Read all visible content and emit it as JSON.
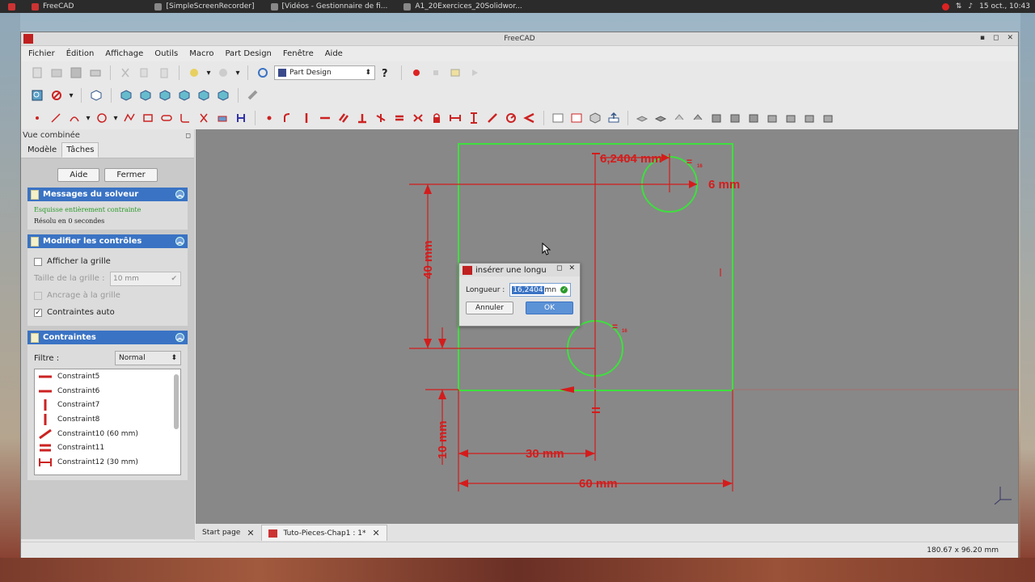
{
  "taskbar": {
    "tasks": [
      "FreeCAD",
      "[SimpleScreenRecorder]",
      "[Vidéos - Gestionnaire de fi...",
      "A1_20Exercices_20Solidwor..."
    ],
    "clock": "15 oct., 10:43"
  },
  "window": {
    "title": "FreeCAD",
    "menu": [
      "Fichier",
      "Édition",
      "Affichage",
      "Outils",
      "Macro",
      "Part Design",
      "Fenêtre",
      "Aide"
    ],
    "workbench": "Part Design"
  },
  "panel": {
    "title": "Vue combinée",
    "tabs": [
      "Modèle",
      "Tâches"
    ],
    "aide": "Aide",
    "fermer": "Fermer",
    "solver": {
      "header": "Messages du solveur",
      "status": "Esquisse entièrement contrainte",
      "resolved": "Résolu en 0 secondes"
    },
    "controls": {
      "header": "Modifier les contrôles",
      "show_grid": "Afficher la grille",
      "grid_size_label": "Taille de la grille :",
      "grid_size_value": "10 mm",
      "grid_snap": "Ancrage à la grille",
      "auto_constraints": "Contraintes auto"
    },
    "constraints": {
      "header": "Contraintes",
      "filter_label": "Filtre :",
      "filter_value": "Normal",
      "items": [
        {
          "icon": "horizontal",
          "label": "Constraint5"
        },
        {
          "icon": "horizontal",
          "label": "Constraint6"
        },
        {
          "icon": "vertical",
          "label": "Constraint7"
        },
        {
          "icon": "vertical",
          "label": "Constraint8"
        },
        {
          "icon": "distance",
          "label": "Constraint10 (60 mm)"
        },
        {
          "icon": "equal",
          "label": "Constraint11"
        },
        {
          "icon": "hdistance",
          "label": "Constraint12 (30 mm)"
        }
      ]
    }
  },
  "sketch": {
    "dims": {
      "top": "6,2404 mm",
      "right": "6 mm",
      "left_vertical": "40 mm",
      "bottom_vertical": "10 mm",
      "h30": "30 mm",
      "h60": "60 mm",
      "eq1": "=",
      "eq2": "=",
      "eq_sub": "16"
    }
  },
  "dialog": {
    "title": "insérer une longu",
    "label": "Longueur :",
    "value_selected": "16,2404",
    "value_unit": "mn",
    "cancel": "Annuler",
    "ok": "OK"
  },
  "doctabs": [
    "Start page",
    "Tuto-Pieces-Chap1 : 1*"
  ],
  "status": "180.67 x 96.20 mm"
}
